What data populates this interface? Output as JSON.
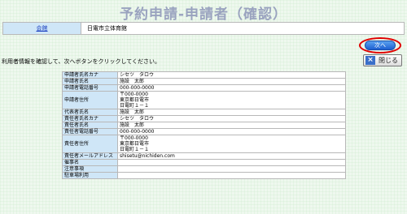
{
  "page": {
    "title": "予約申請-申請者（確認）"
  },
  "venue": {
    "header_label": "会館",
    "value": "日電市立体育館"
  },
  "buttons": {
    "next_label": "次へ",
    "close_label": "閉じる"
  },
  "instruction": "利用者情報を確認して、次へボタンをクリックしてください。",
  "info_rows": [
    {
      "label": "申請者氏名カナ",
      "value": "シセツ　タロウ"
    },
    {
      "label": "申請者氏名",
      "value": "施設　太郎"
    },
    {
      "label": "申請者電話番号",
      "value": "000-000-0000"
    },
    {
      "label": "申請者住所",
      "value": "〒000-0000\n東京都日電市\n日電町１－１"
    },
    {
      "label": "代表者氏名",
      "value": "施設　太郎"
    },
    {
      "label": "責任者氏名カナ",
      "value": "シセツ　タロウ"
    },
    {
      "label": "責任者氏名",
      "value": "施設　太郎"
    },
    {
      "label": "責任者電話番号",
      "value": "000-000-0000"
    },
    {
      "label": "責任者住所",
      "value": "〒000-0000\n東京都日電市\n日電町１－１"
    },
    {
      "label": "責任者メールアドレス",
      "value": "shisetu@nichiden.com"
    },
    {
      "label": "催事名",
      "value": ""
    },
    {
      "label": "注意事項",
      "value": ""
    },
    {
      "label": "駐車場利用",
      "value": ""
    }
  ]
}
